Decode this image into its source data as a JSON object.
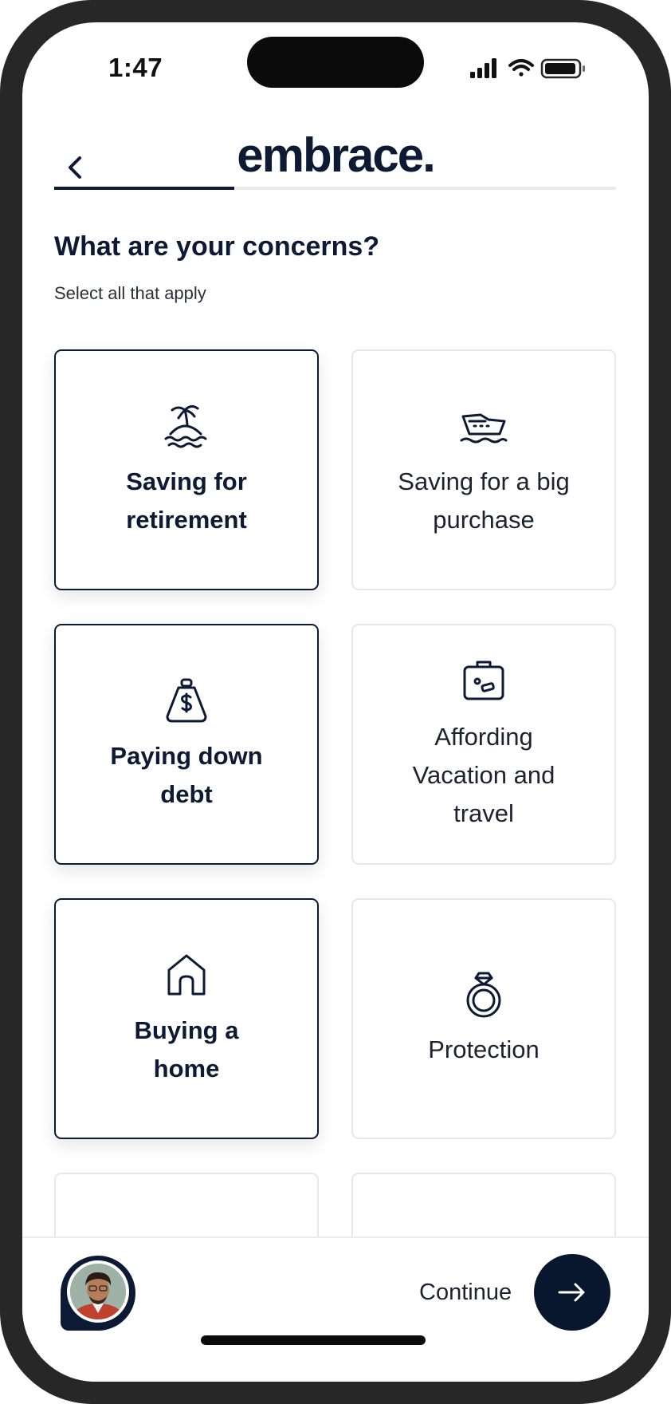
{
  "status_bar": {
    "time": "1:47"
  },
  "header": {
    "logo": "embrace.",
    "progress": 0.32
  },
  "page": {
    "title": "What are your concerns?",
    "subtitle": "Select all that apply"
  },
  "cards": [
    {
      "label": "Saving for retirement",
      "icon": "island-icon",
      "selected": true
    },
    {
      "label": "Saving for a big purchase",
      "icon": "yacht-icon",
      "selected": false
    },
    {
      "label": "Paying down debt",
      "icon": "money-bag-icon",
      "selected": true
    },
    {
      "label": "Affording Vacation and travel",
      "icon": "luggage-icon",
      "selected": false
    },
    {
      "label": "Buying a home",
      "icon": "house-icon",
      "selected": true
    },
    {
      "label": "Protection",
      "icon": "ring-icon",
      "selected": false
    }
  ],
  "footer": {
    "continue_label": "Continue"
  },
  "colors": {
    "brand": "#0c1a33",
    "border": "#e8e8e8"
  }
}
